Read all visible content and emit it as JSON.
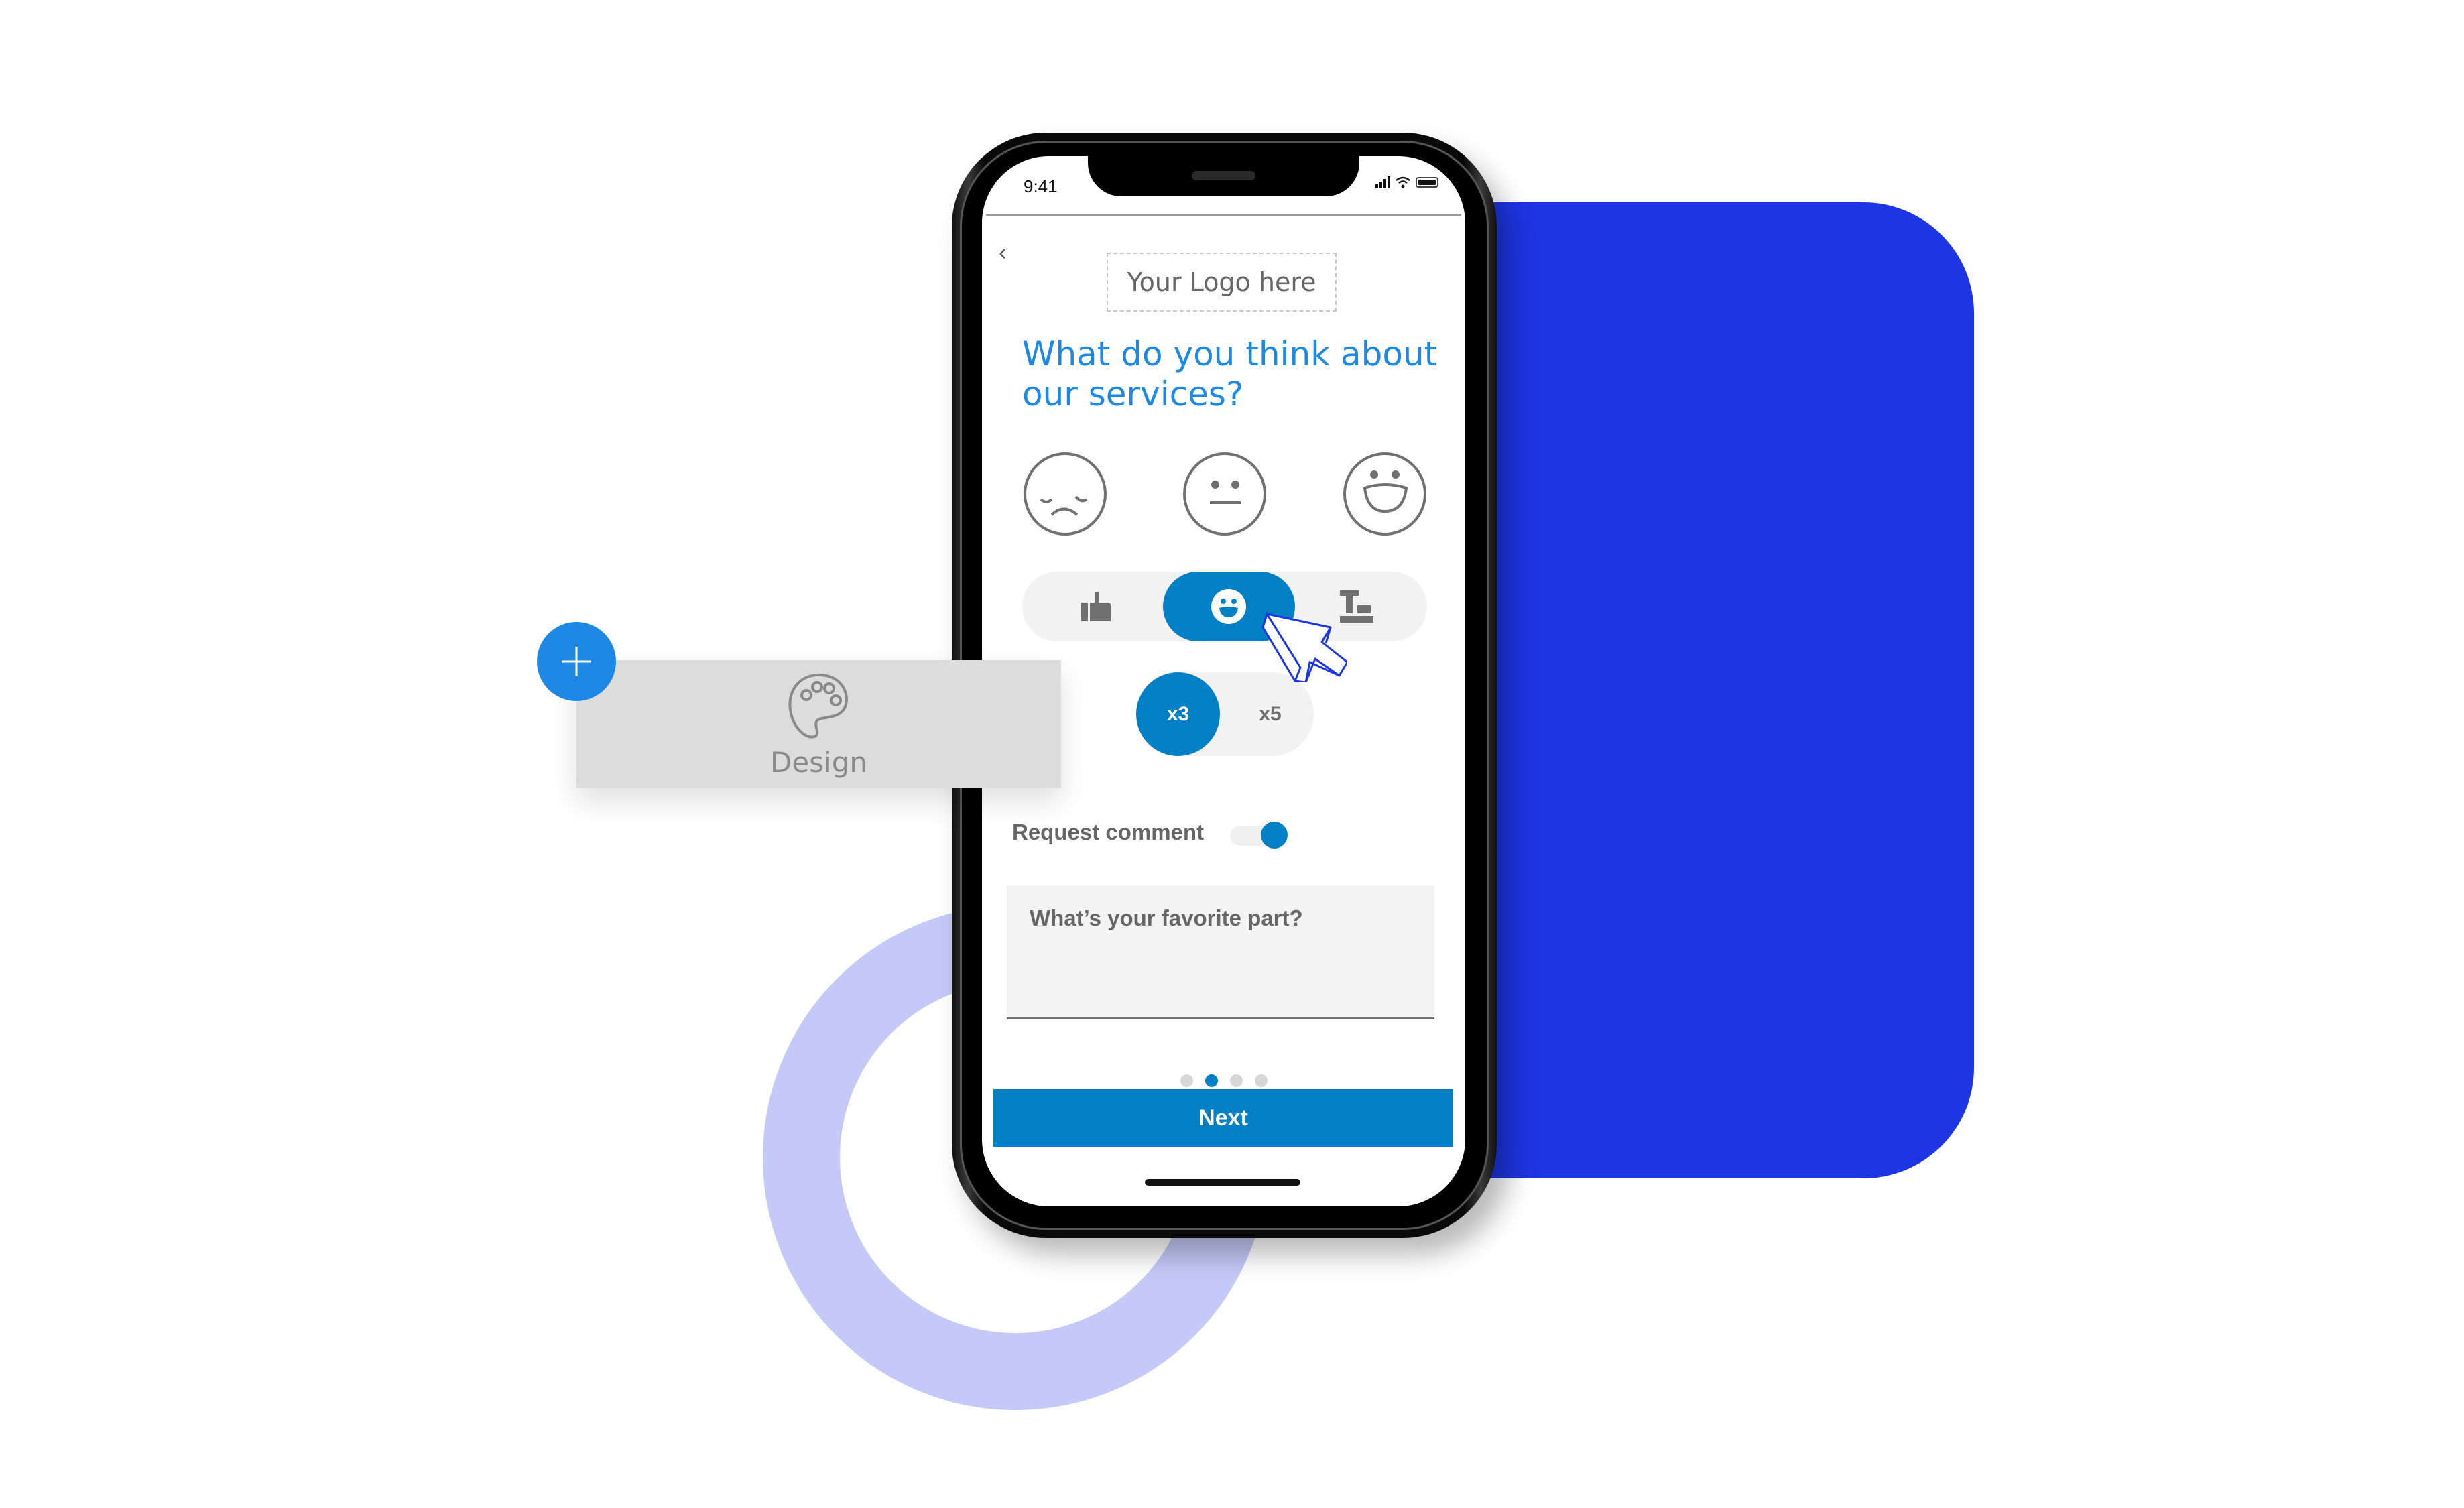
{
  "colors": {
    "accent": "#0280c6",
    "question_text": "#1e88e5",
    "background_shape": "#1d35e3",
    "ring": "#c4c9f7",
    "design_card": "#dcdcdc",
    "plus_button": "#1e88e5"
  },
  "status_bar": {
    "time": "9:41",
    "icons": [
      "signal-icon",
      "wifi-icon",
      "battery-icon"
    ]
  },
  "header": {
    "back_icon": "chevron-left-icon",
    "back_glyph": "‹",
    "logo_placeholder": "Your Logo here"
  },
  "survey": {
    "question": "What do you think about our services?",
    "faces": [
      {
        "name": "sad-face-icon",
        "label": "sad"
      },
      {
        "name": "neutral-face-icon",
        "label": "neutral"
      },
      {
        "name": "happy-face-icon",
        "label": "happy"
      }
    ],
    "rating_types": [
      {
        "name": "thumbs-up-icon",
        "selected": false
      },
      {
        "name": "smiley-icon",
        "selected": true
      },
      {
        "name": "text-format-icon",
        "selected": false
      }
    ],
    "scale_options": [
      {
        "label": "x3",
        "selected": true
      },
      {
        "label": "x5",
        "selected": false
      }
    ],
    "request_comment": {
      "label": "Request comment",
      "enabled": true
    },
    "comment_placeholder": "What’s your favorite part?",
    "pagination": {
      "total": 4,
      "current": 2
    },
    "next_label": "Next"
  },
  "design_panel": {
    "label": "Design",
    "icon": "palette-icon",
    "add_icon": "plus-icon"
  }
}
